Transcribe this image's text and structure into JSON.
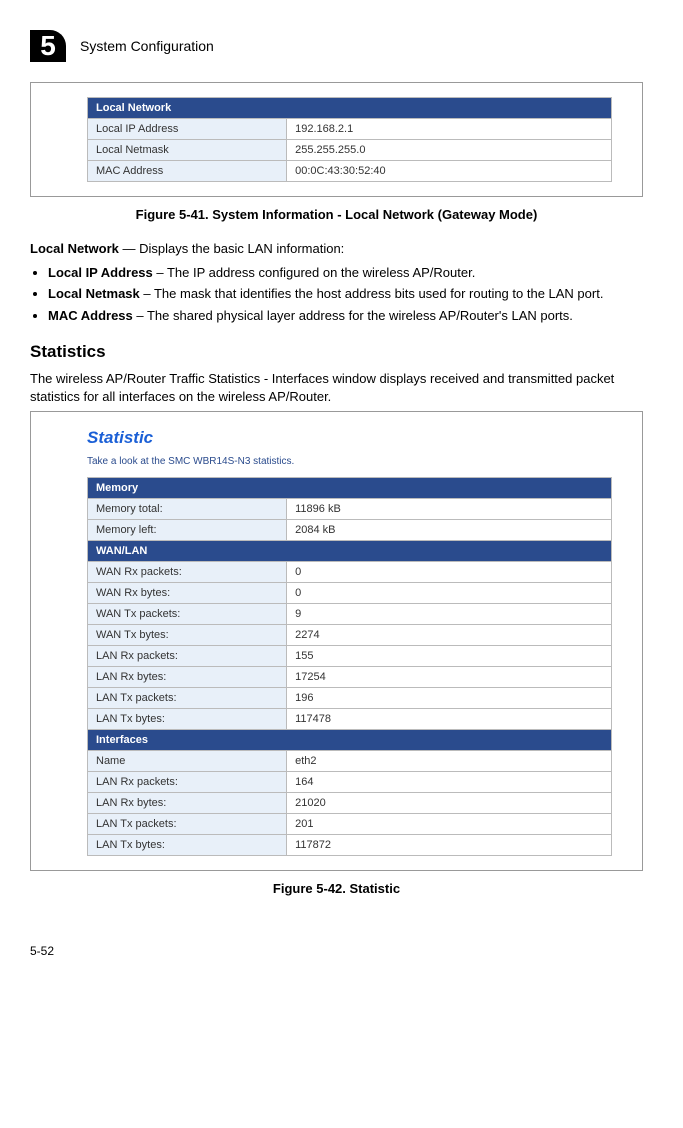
{
  "header": {
    "chapter_number": "5",
    "chapter_title": "System Configuration"
  },
  "fig41": {
    "section_header": "Local Network",
    "rows": [
      {
        "label": "Local IP Address",
        "value": "192.168.2.1"
      },
      {
        "label": "Local Netmask",
        "value": "255.255.255.0"
      },
      {
        "label": "MAC Address",
        "value": "00:0C:43:30:52:40"
      }
    ],
    "caption": "Figure 5-41.   System Information - Local Network (Gateway Mode)"
  },
  "local_network_text": {
    "lead_bold": "Local Network",
    "lead_rest": " — Displays the basic LAN information:",
    "items": [
      {
        "bold": "Local IP Address",
        "rest": " – The IP address configured on the wireless AP/Router."
      },
      {
        "bold": "Local Netmask",
        "rest": " – The mask that identifies the host address bits used for routing to the LAN port."
      },
      {
        "bold": "MAC Address",
        "rest": " – The shared physical layer address for the wireless AP/Router's LAN ports."
      }
    ]
  },
  "statistics": {
    "heading": "Statistics",
    "intro": "The wireless AP/Router Traffic Statistics - Interfaces window displays received and transmitted packet statistics for all interfaces on the wireless AP/Router."
  },
  "fig42": {
    "title": "Statistic",
    "subtitle": "Take a look at the SMC WBR14S-N3 statistics.",
    "memory_header": "Memory",
    "memory_rows": [
      {
        "label": "Memory total:",
        "value": "11896 kB"
      },
      {
        "label": "Memory left:",
        "value": "2084 kB"
      }
    ],
    "wanlan_header": "WAN/LAN",
    "wanlan_rows": [
      {
        "label": "WAN Rx packets:",
        "value": "0"
      },
      {
        "label": "WAN Rx bytes:",
        "value": "0"
      },
      {
        "label": "WAN Tx packets:",
        "value": "9"
      },
      {
        "label": "WAN Tx bytes:",
        "value": "2274"
      },
      {
        "label": "LAN Rx packets:",
        "value": "155"
      },
      {
        "label": "LAN Rx bytes:",
        "value": "17254"
      },
      {
        "label": "LAN Tx packets:",
        "value": "196"
      },
      {
        "label": "LAN Tx bytes:",
        "value": "117478"
      }
    ],
    "interfaces_header": "Interfaces",
    "interfaces_rows": [
      {
        "label": "Name",
        "value": "eth2"
      },
      {
        "label": "LAN Rx packets:",
        "value": "164"
      },
      {
        "label": "LAN Rx bytes:",
        "value": "21020"
      },
      {
        "label": "LAN Tx packets:",
        "value": "201"
      },
      {
        "label": "LAN Tx bytes:",
        "value": "117872"
      }
    ],
    "caption": "Figure 5-42.   Statistic"
  },
  "page_number": "5-52"
}
